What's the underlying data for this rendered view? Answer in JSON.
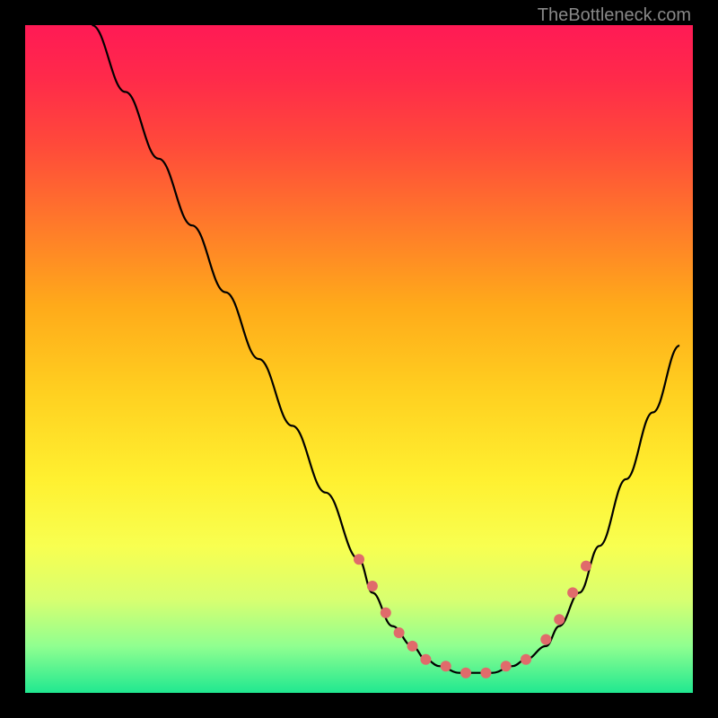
{
  "watermark": "TheBottleneck.com",
  "chart_data": {
    "type": "line",
    "title": "",
    "xlabel": "",
    "ylabel": "",
    "xlim": [
      0,
      100
    ],
    "ylim": [
      0,
      100
    ],
    "series": [
      {
        "name": "bottleneck-curve",
        "color": "#000000",
        "x": [
          10,
          15,
          20,
          25,
          30,
          35,
          40,
          45,
          50,
          52,
          55,
          58,
          60,
          62,
          65,
          68,
          70,
          73,
          75,
          78,
          80,
          83,
          86,
          90,
          94,
          98
        ],
        "y": [
          100,
          90,
          80,
          70,
          60,
          50,
          40,
          30,
          20,
          15,
          10,
          7,
          5,
          4,
          3,
          3,
          3,
          4,
          5,
          7,
          10,
          15,
          22,
          32,
          42,
          52
        ]
      }
    ],
    "markers": {
      "name": "highlight-dots",
      "color": "#e06b6b",
      "x": [
        50,
        52,
        54,
        56,
        58,
        60,
        63,
        66,
        69,
        72,
        75,
        78,
        80,
        82,
        84
      ],
      "y": [
        20,
        16,
        12,
        9,
        7,
        5,
        4,
        3,
        3,
        4,
        5,
        8,
        11,
        15,
        19
      ]
    }
  }
}
